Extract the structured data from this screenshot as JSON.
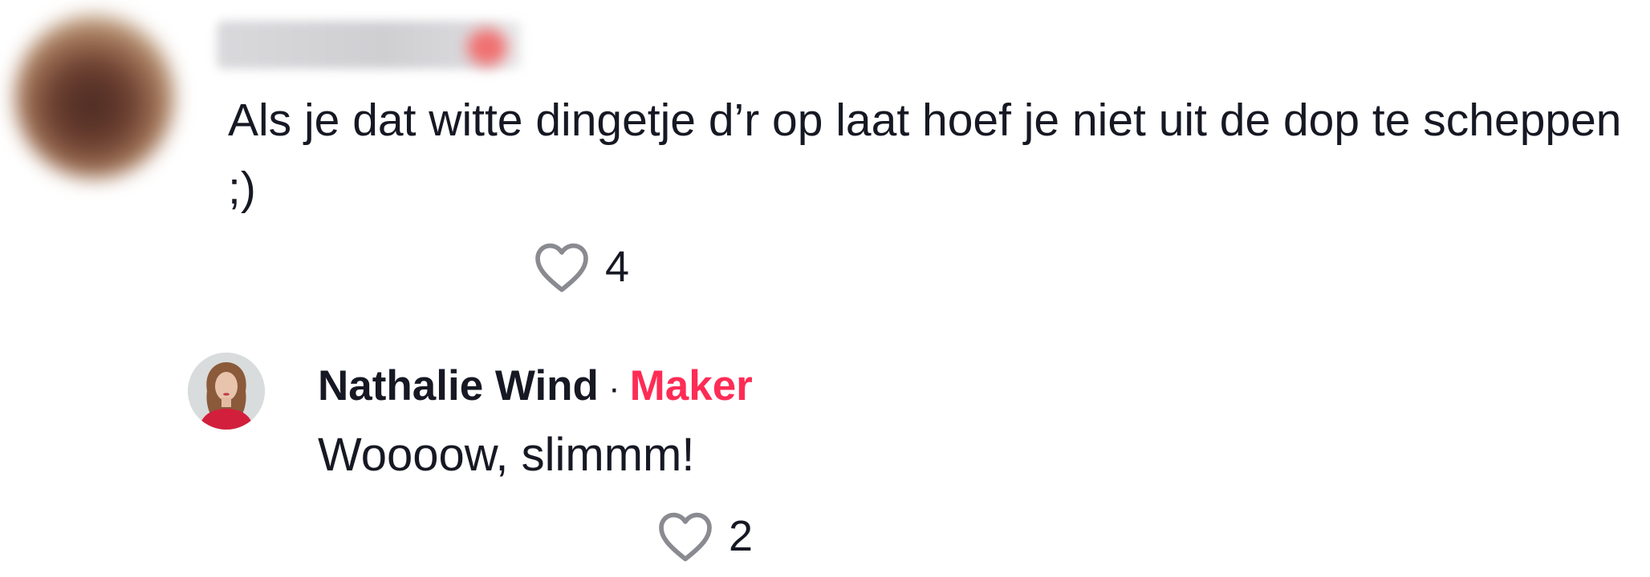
{
  "comment": {
    "text": "Als je dat witte dingetje d’r op laat hoef je niet uit de dop te scheppen ;)",
    "likes": "4",
    "like_icon": "heart-outline-icon"
  },
  "reply": {
    "author": "Nathalie Wind",
    "separator": "·",
    "badge": "Maker",
    "text": "Woooow, slimmm!",
    "likes": "2",
    "like_icon": "heart-outline-icon"
  },
  "colors": {
    "text": "#161823",
    "maker_badge": "#fe2c55",
    "icon": "#8a8b91"
  }
}
